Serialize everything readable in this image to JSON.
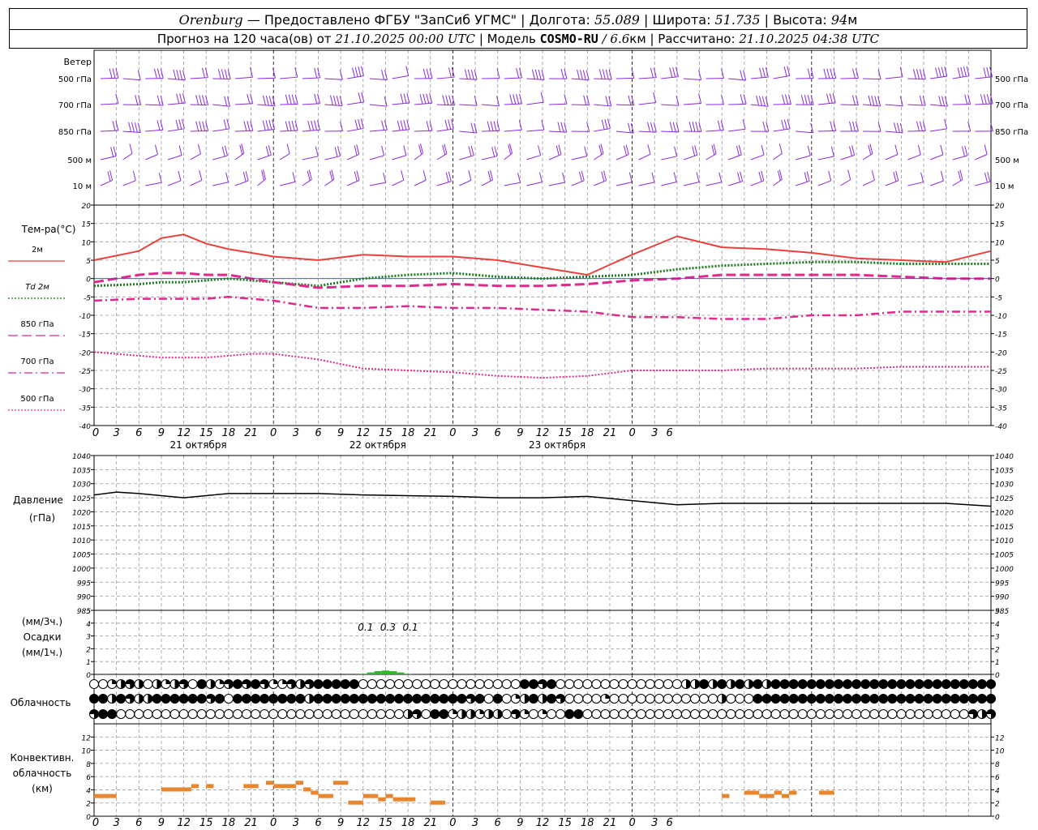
{
  "header": {
    "city": "Orenburg",
    "dash": " — ",
    "provider": "Предоставлено ФГБУ \"ЗапСиб УГМС\"",
    "lon_label": "Долгота:",
    "lon_value": "55.089",
    "lat_label": "Широта:",
    "lat_value": "51.735",
    "alt_label": "Высота:",
    "alt_value": "94",
    "alt_unit": "м",
    "forecast_label": "Прогноз на 120 часа(ов) от",
    "forecast_start": "21.10.2025 00:00 UTC",
    "model_label": "Модель",
    "model_name": "COSMO-RU",
    "resolution": "/ 6.6",
    "resolution_unit": "км",
    "computed_label": "Рассчитано:",
    "computed_value": "21.10.2025 04:38 UTC"
  },
  "wind_panel": {
    "title": "Ветер",
    "levels": [
      "500 гПа",
      "700 гПа",
      "850 гПа",
      "500 м",
      "10 м"
    ],
    "color": "#8a2be2"
  },
  "temp_panel": {
    "title": "Тем-ра(°C)",
    "legend": [
      {
        "label": "2м",
        "color": "#e8413c",
        "style": "solid"
      },
      {
        "label": "Td 2м",
        "color": "#1a7a1a",
        "style": "dotted"
      },
      {
        "label": "850 гПа",
        "color": "#e0298c",
        "style": "dashed"
      },
      {
        "label": "700 гПа",
        "color": "#e0298c",
        "style": "dashdot"
      },
      {
        "label": "500 гПа",
        "color": "#e0298c",
        "style": "dotted"
      }
    ]
  },
  "pressure_panel": {
    "title1": "Давление",
    "title2": "(гПа)"
  },
  "precip_panel": {
    "title1": "(мм/3ч.)",
    "title2": "Осадки",
    "title3": "(мм/1ч.)"
  },
  "cloud_panel": {
    "title": "Облачность"
  },
  "conv_panel": {
    "title1": "Конвективн.",
    "title2": "облачность",
    "title3": "(км)",
    "color": "#e8862e"
  },
  "time_axis": {
    "hour_labels": [
      "0",
      "3",
      "6",
      "9",
      "12",
      "15",
      "18",
      "21",
      "0",
      "3",
      "6",
      "9",
      "12",
      "15",
      "18",
      "21",
      "0",
      "3",
      "6",
      "9",
      "12",
      "15",
      "18",
      "21",
      "0",
      "3",
      "6"
    ],
    "day_labels": [
      "21 октября",
      "22 октября",
      "23 октября"
    ]
  },
  "chart_data": [
    {
      "type": "line",
      "panel": "temperature",
      "x_hours": [
        0,
        6,
        9,
        12,
        15,
        18,
        21,
        24,
        30,
        36,
        42,
        48,
        54,
        60,
        66,
        72,
        78,
        84,
        90,
        96,
        102,
        108,
        114,
        120
      ],
      "ylim": [
        -40,
        20
      ],
      "yticks": [
        20,
        15,
        10,
        5,
        0,
        -5,
        -10,
        -15,
        -20,
        -25,
        -30,
        -35,
        -40
      ],
      "series": [
        {
          "name": "2м",
          "values": [
            5,
            7.5,
            11,
            12,
            9.5,
            8,
            7,
            6,
            5,
            6.5,
            6,
            6,
            5,
            3,
            1,
            6.5,
            11.5,
            8.5,
            8,
            7,
            5.5,
            5,
            4.5,
            7.5
          ]
        },
        {
          "name": "Td 2м",
          "values": [
            -2,
            -1.5,
            -1,
            -1,
            -0.5,
            0,
            -0.5,
            -1,
            -2,
            0,
            1,
            1.5,
            0.5,
            0,
            0.5,
            1,
            2.5,
            3.5,
            4,
            4.5,
            4.5,
            4,
            4,
            4
          ]
        },
        {
          "name": "850 гПа",
          "values": [
            -1,
            1,
            1.5,
            1.5,
            1,
            1,
            0,
            -1,
            -2.5,
            -2,
            -2,
            -1.5,
            -2,
            -2,
            -1.5,
            -0.5,
            0,
            1,
            1,
            1,
            1,
            0.5,
            0,
            0
          ]
        },
        {
          "name": "700 гПа",
          "values": [
            -6,
            -5.5,
            -5.5,
            -5.5,
            -5.5,
            -5,
            -5.5,
            -6,
            -8,
            -8,
            -7.5,
            -8,
            -8,
            -8.5,
            -9,
            -10.5,
            -10.5,
            -11,
            -11,
            -10,
            -10,
            -9,
            -9,
            -9
          ]
        },
        {
          "name": "500 гПа",
          "values": [
            -20,
            -21,
            -21.5,
            -21.5,
            -21.5,
            -21,
            -20.5,
            -20.5,
            -22,
            -24.5,
            -25,
            -25.5,
            -26.5,
            -27,
            -26.5,
            -25,
            -25,
            -25,
            -24.5,
            -24.5,
            -24.5,
            -24,
            -24,
            -24
          ]
        }
      ]
    },
    {
      "type": "line",
      "panel": "pressure",
      "x_hours": [
        0,
        3,
        6,
        12,
        18,
        24,
        30,
        36,
        48,
        54,
        60,
        66,
        72,
        78,
        84,
        90,
        96,
        108,
        114,
        120
      ],
      "ylim": [
        985,
        1040
      ],
      "yticks": [
        1040,
        1035,
        1030,
        1025,
        1020,
        1015,
        1010,
        1005,
        1000,
        995,
        990,
        985
      ],
      "values": [
        1026,
        1027,
        1026.5,
        1025,
        1026.5,
        1026.5,
        1026.5,
        1026,
        1025.5,
        1025,
        1025,
        1025.5,
        1024,
        1022.5,
        1023,
        1023,
        1023,
        1023,
        1023,
        1022
      ]
    },
    {
      "type": "bar",
      "panel": "precipitation",
      "ylim": [
        0,
        5
      ],
      "yticks": [
        5,
        4,
        3,
        2,
        1,
        0
      ],
      "labels": [
        {
          "hour": 36,
          "text": "0.1"
        },
        {
          "hour": 39,
          "text": "0.3"
        },
        {
          "hour": 42,
          "text": "0.1"
        }
      ],
      "x_hours": [
        36,
        37,
        38,
        39,
        40,
        41,
        42
      ],
      "values": [
        0.05,
        0.15,
        0.25,
        0.3,
        0.25,
        0.15,
        0.05
      ],
      "color": "#2bb82b"
    },
    {
      "type": "bar",
      "panel": "convective_cloud",
      "ylim": [
        0,
        14
      ],
      "yticks": [
        12,
        10,
        8,
        6,
        4,
        2,
        0
      ],
      "segments": [
        {
          "from": 0,
          "to": 3,
          "value": 3
        },
        {
          "from": 9,
          "to": 13,
          "value": 4
        },
        {
          "from": 13,
          "to": 14,
          "value": 4.5
        },
        {
          "from": 15,
          "to": 16,
          "value": 4.5
        },
        {
          "from": 20,
          "to": 22,
          "value": 4.5
        },
        {
          "from": 23,
          "to": 24,
          "value": 5
        },
        {
          "from": 24,
          "to": 27,
          "value": 4.5
        },
        {
          "from": 27,
          "to": 28,
          "value": 5
        },
        {
          "from": 28,
          "to": 29,
          "value": 4
        },
        {
          "from": 29,
          "to": 30,
          "value": 3.5
        },
        {
          "from": 30,
          "to": 32,
          "value": 3
        },
        {
          "from": 32,
          "to": 34,
          "value": 5
        },
        {
          "from": 34,
          "to": 36,
          "value": 2
        },
        {
          "from": 36,
          "to": 38,
          "value": 3
        },
        {
          "from": 38,
          "to": 39,
          "value": 2.5
        },
        {
          "from": 39,
          "to": 40,
          "value": 3
        },
        {
          "from": 40,
          "to": 43,
          "value": 2.5
        },
        {
          "from": 45,
          "to": 47,
          "value": 2
        },
        {
          "from": 84,
          "to": 85,
          "value": 3
        },
        {
          "from": 87,
          "to": 89,
          "value": 3.5
        },
        {
          "from": 89,
          "to": 91,
          "value": 3
        },
        {
          "from": 91,
          "to": 92,
          "value": 3.5
        },
        {
          "from": 92,
          "to": 93,
          "value": 3
        },
        {
          "from": 93,
          "to": 94,
          "value": 3.5
        },
        {
          "from": 97,
          "to": 99,
          "value": 3.5
        }
      ]
    },
    {
      "type": "table",
      "panel": "cloudiness",
      "legend_note": "0=clear 1=quarter 2=half 3=three-quarter 4=overcast",
      "rows": [
        [
          0,
          0,
          1,
          2,
          3,
          2,
          0,
          2,
          1,
          2,
          3,
          0,
          4,
          2,
          1,
          3,
          4,
          3,
          4,
          3,
          1,
          1,
          3,
          2,
          3,
          4,
          4,
          4,
          4,
          4,
          0,
          0,
          0,
          0,
          0,
          0,
          0,
          0,
          0,
          0,
          0,
          0,
          0,
          0,
          0,
          0,
          0,
          0,
          4,
          4,
          3,
          4,
          0,
          0,
          0,
          0,
          0,
          0,
          0,
          0,
          0,
          0,
          0,
          0,
          0,
          0,
          2,
          2,
          4,
          2,
          4,
          2,
          4,
          2,
          4,
          2,
          4,
          4,
          4,
          4,
          4,
          4,
          4,
          4,
          4,
          4,
          4,
          4,
          4,
          4,
          4,
          4,
          4,
          4,
          4,
          4,
          4,
          4,
          4,
          4,
          4
        ],
        [
          4,
          4,
          2,
          4,
          3,
          2,
          2,
          4,
          4,
          4,
          4,
          4,
          4,
          3,
          4,
          0,
          4,
          4,
          4,
          4,
          4,
          4,
          4,
          4,
          2,
          4,
          4,
          4,
          4,
          4,
          4,
          4,
          4,
          4,
          4,
          4,
          4,
          4,
          4,
          4,
          4,
          4,
          3,
          4,
          0,
          4,
          0,
          1,
          2,
          4,
          2,
          4,
          3,
          0,
          0,
          0,
          0,
          1,
          0,
          0,
          0,
          0,
          0,
          0,
          0,
          0,
          0,
          0,
          0,
          0,
          2,
          0,
          0,
          0,
          4,
          4,
          4,
          4,
          4,
          4,
          4,
          4,
          4,
          4,
          4,
          4,
          4,
          4,
          4,
          4,
          4,
          4,
          4,
          4,
          4,
          4,
          4,
          4,
          4,
          4,
          4
        ],
        [
          3,
          4,
          4,
          0,
          0,
          0,
          0,
          0,
          0,
          0,
          0,
          0,
          0,
          0,
          0,
          0,
          0,
          0,
          0,
          0,
          0,
          0,
          0,
          0,
          0,
          0,
          0,
          0,
          0,
          0,
          0,
          0,
          0,
          0,
          0,
          2,
          3,
          0,
          4,
          4,
          1,
          2,
          2,
          1,
          2,
          2,
          0,
          3,
          1,
          0,
          1,
          0,
          0,
          4,
          4,
          0,
          0,
          0,
          0,
          0,
          0,
          0,
          0,
          0,
          0,
          0,
          0,
          0,
          0,
          0,
          0,
          0,
          0,
          0,
          0,
          0,
          0,
          0,
          0,
          0,
          0,
          0,
          0,
          0,
          0,
          0,
          0,
          0,
          0,
          0,
          0,
          0,
          0,
          0,
          0,
          0,
          0,
          0,
          3,
          2,
          3
        ]
      ]
    }
  ]
}
